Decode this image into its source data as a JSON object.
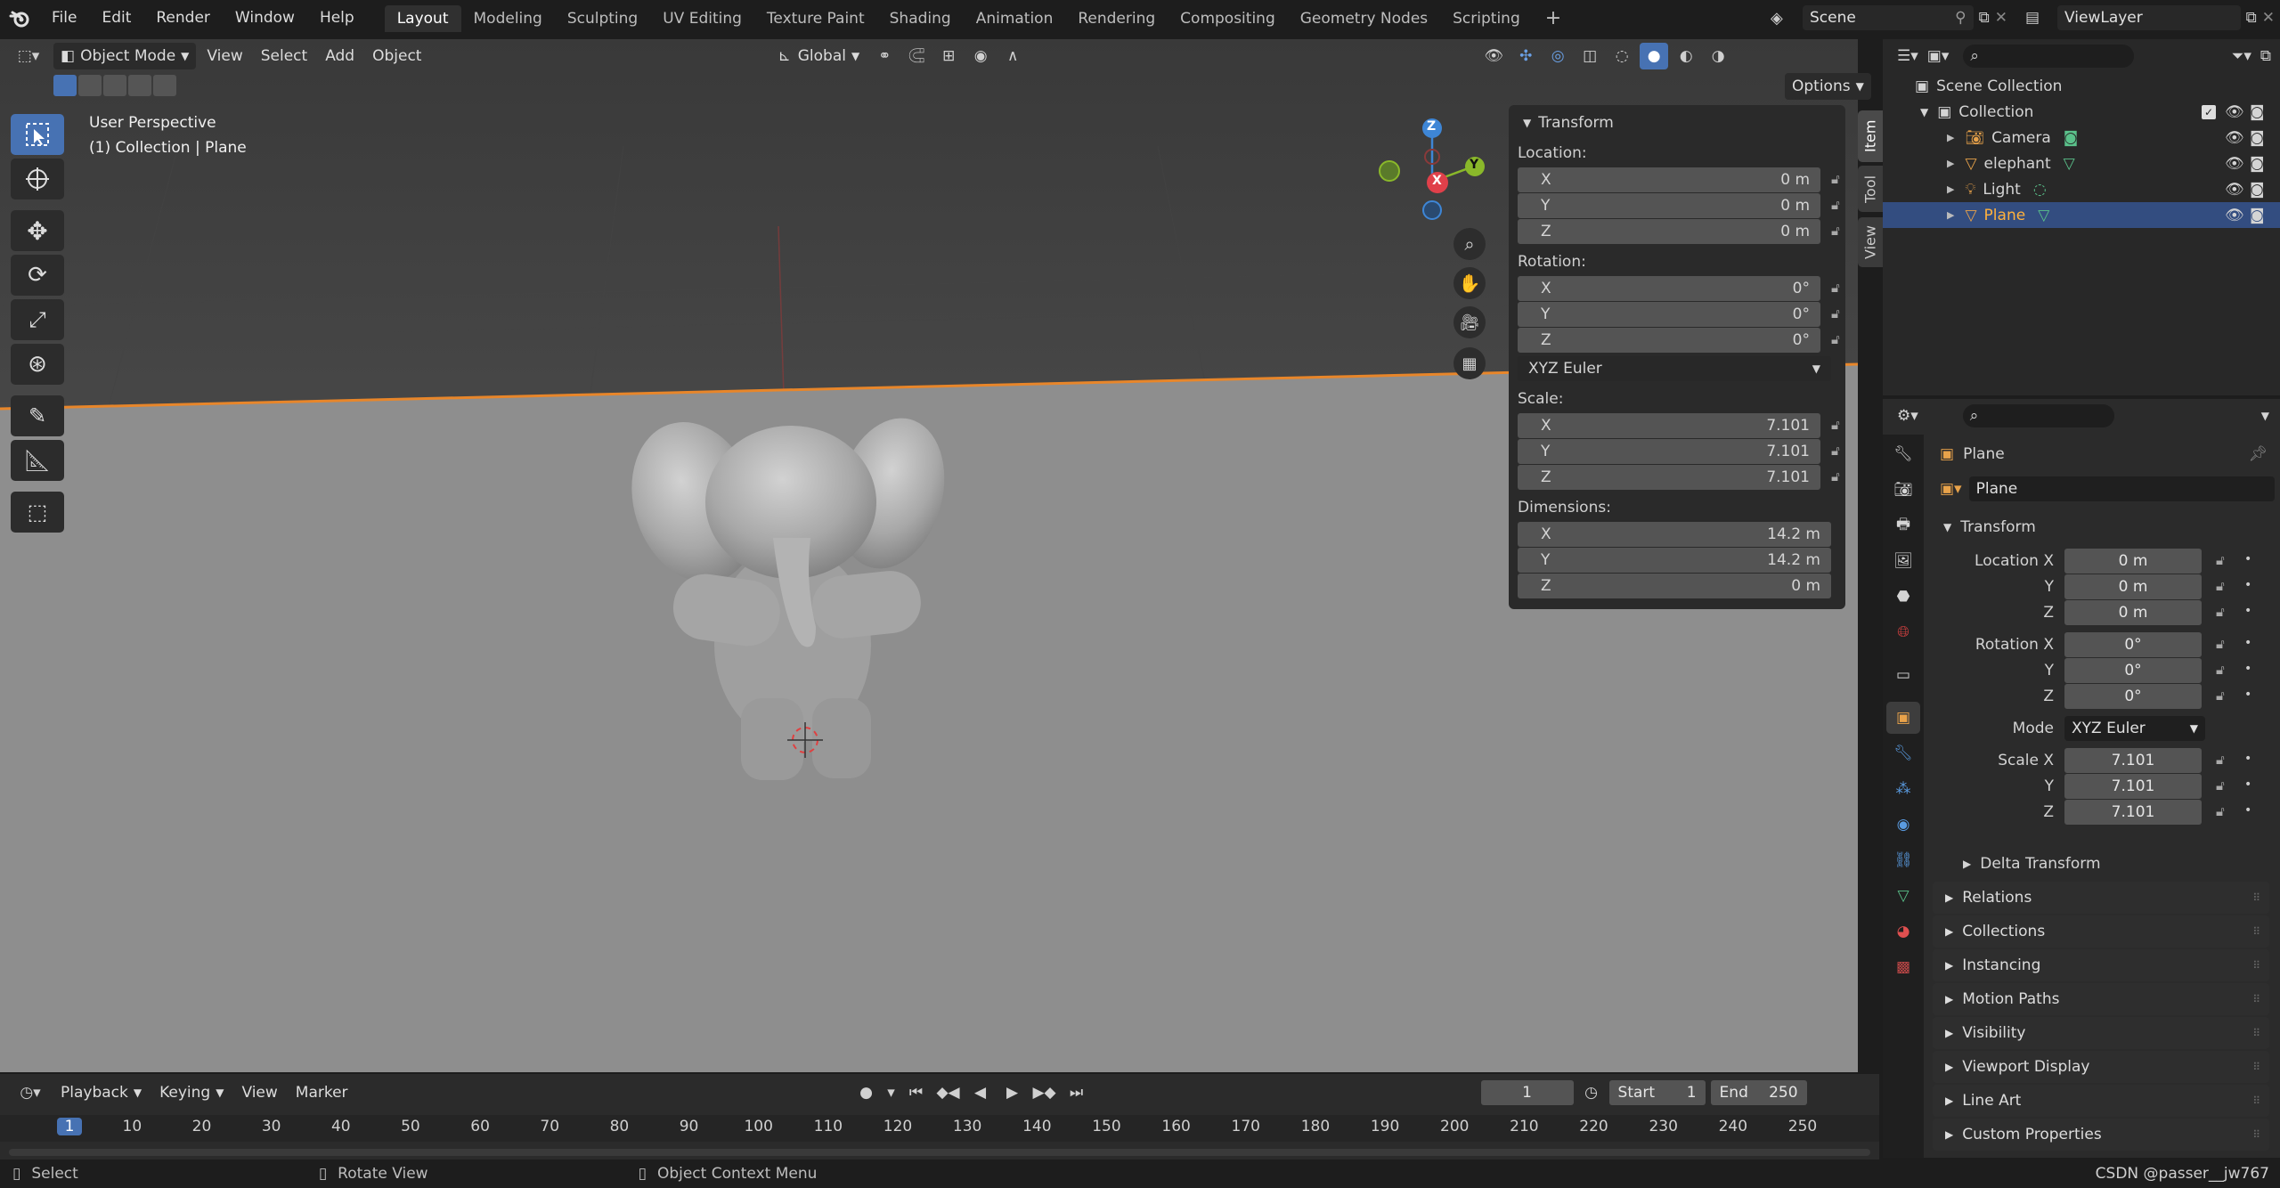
{
  "menu": {
    "items": [
      "File",
      "Edit",
      "Render",
      "Window",
      "Help"
    ],
    "workspaces": [
      "Layout",
      "Modeling",
      "Sculpting",
      "UV Editing",
      "Texture Paint",
      "Shading",
      "Animation",
      "Rendering",
      "Compositing",
      "Geometry Nodes",
      "Scripting"
    ],
    "active_workspace": "Layout",
    "add_tab": "+",
    "scene": "Scene",
    "view_layer": "ViewLayer"
  },
  "viewport_header": {
    "mode": "Object Mode",
    "menus": [
      "View",
      "Select",
      "Add",
      "Object"
    ],
    "orientation": "Global",
    "options": "Options"
  },
  "viewport": {
    "perspective": "User Perspective",
    "context": "(1) Collection | Plane",
    "gizmo": {
      "x": "X",
      "y": "Y",
      "z": "Z"
    }
  },
  "npanel": {
    "title": "Transform",
    "location_label": "Location:",
    "location": [
      {
        "axis": "X",
        "value": "0 m"
      },
      {
        "axis": "Y",
        "value": "0 m"
      },
      {
        "axis": "Z",
        "value": "0 m"
      }
    ],
    "rotation_label": "Rotation:",
    "rotation": [
      {
        "axis": "X",
        "value": "0°"
      },
      {
        "axis": "Y",
        "value": "0°"
      },
      {
        "axis": "Z",
        "value": "0°"
      }
    ],
    "rotation_mode": "XYZ Euler",
    "scale_label": "Scale:",
    "scale": [
      {
        "axis": "X",
        "value": "7.101"
      },
      {
        "axis": "Y",
        "value": "7.101"
      },
      {
        "axis": "Z",
        "value": "7.101"
      }
    ],
    "dimensions_label": "Dimensions:",
    "dimensions": [
      {
        "axis": "X",
        "value": "14.2 m"
      },
      {
        "axis": "Y",
        "value": "14.2 m"
      },
      {
        "axis": "Z",
        "value": "0 m"
      }
    ],
    "tabs": [
      "Item",
      "Tool",
      "View"
    ]
  },
  "outliner": {
    "scene_collection": "Scene Collection",
    "collection": "Collection",
    "items": [
      {
        "name": "Camera",
        "color": "#e8a24a"
      },
      {
        "name": "elephant",
        "color": "#e8a24a"
      },
      {
        "name": "Light",
        "color": "#e8a24a"
      },
      {
        "name": "Plane",
        "color": "#e8a24a"
      }
    ],
    "selected": "Plane"
  },
  "properties": {
    "object_name": "Plane",
    "data_name": "Plane",
    "transform_title": "Transform",
    "location_x_label": "Location X",
    "y_label": "Y",
    "z_label": "Z",
    "location": [
      "0 m",
      "0 m",
      "0 m"
    ],
    "rotation_x_label": "Rotation X",
    "rotation": [
      "0°",
      "0°",
      "0°"
    ],
    "mode_label": "Mode",
    "mode": "XYZ Euler",
    "scale_x_label": "Scale X",
    "scale": [
      "7.101",
      "7.101",
      "7.101"
    ],
    "delta_transform": "Delta Transform",
    "sections": [
      "Relations",
      "Collections",
      "Instancing",
      "Motion Paths",
      "Visibility",
      "Viewport Display",
      "Line Art",
      "Custom Properties"
    ]
  },
  "timeline": {
    "menus": [
      "Playback",
      "Keying",
      "View",
      "Marker"
    ],
    "current_frame": "1",
    "start_label": "Start",
    "start": "1",
    "end_label": "End",
    "end": "250",
    "ticks": [
      "1",
      "10",
      "20",
      "30",
      "40",
      "50",
      "60",
      "70",
      "80",
      "90",
      "100",
      "110",
      "120",
      "130",
      "140",
      "150",
      "160",
      "170",
      "180",
      "190",
      "200",
      "210",
      "220",
      "230",
      "240",
      "250"
    ]
  },
  "statusbar": {
    "select": "Select",
    "rotate_view": "Rotate View",
    "context_menu": "Object Context Menu",
    "watermark": "CSDN @passer__jw767"
  },
  "colors": {
    "accent": "#4772b3",
    "selected_row": "#334d80",
    "orange": "#e8a24a",
    "axis_x": "#e0404a",
    "axis_y": "#8ab82a",
    "axis_z": "#3e86d6"
  }
}
